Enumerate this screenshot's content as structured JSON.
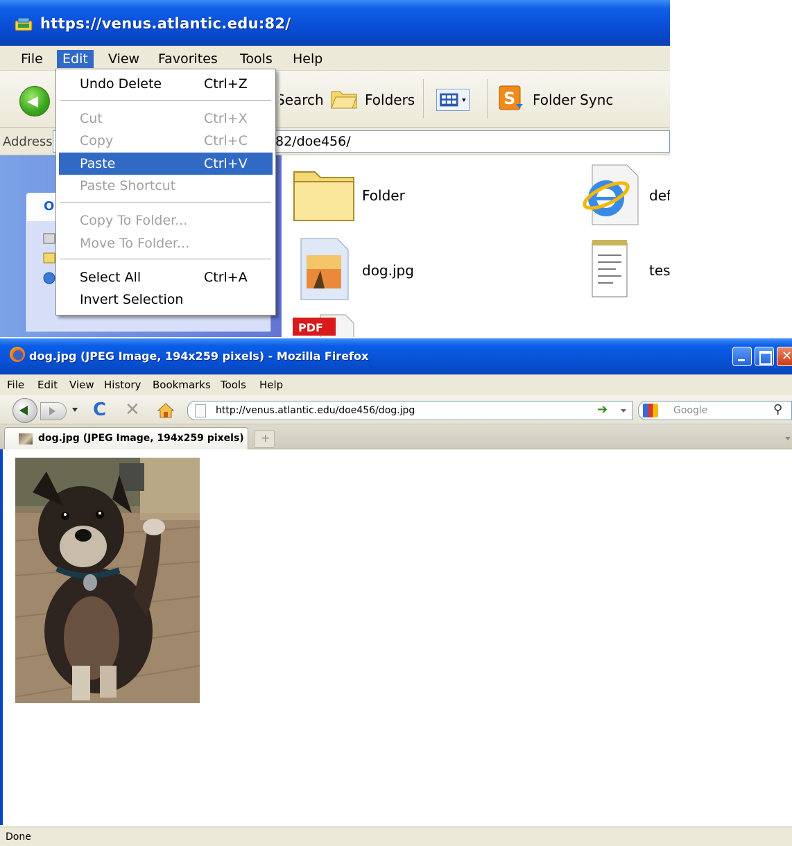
{
  "explorer": {
    "title": "https://venus.atlantic.edu:82/",
    "menu": [
      "File",
      "Edit",
      "View",
      "Favorites",
      "Tools",
      "Help"
    ],
    "toolbar": {
      "search_label": "Search",
      "folders_label": "Folders",
      "folder_sync_label": "Folder Sync"
    },
    "address": {
      "label": "Address",
      "value": "82/doe456/"
    },
    "task_panel_header": "O",
    "files": [
      {
        "name": "Folder",
        "type": "folder"
      },
      {
        "name": "def",
        "type": "ie-document"
      },
      {
        "name": "dog.jpg",
        "type": "image"
      },
      {
        "name": "tes",
        "type": "text-document"
      },
      {
        "name": "",
        "type": "pdf"
      }
    ],
    "edit_menu": {
      "items": [
        {
          "label": "Undo Delete",
          "shortcut": "Ctrl+Z",
          "state": "enabled"
        },
        {
          "label": "Cut",
          "shortcut": "Ctrl+X",
          "state": "disabled"
        },
        {
          "label": "Copy",
          "shortcut": "Ctrl+C",
          "state": "disabled"
        },
        {
          "label": "Paste",
          "shortcut": "Ctrl+V",
          "state": "highlighted"
        },
        {
          "label": "Paste Shortcut",
          "shortcut": "",
          "state": "disabled"
        },
        {
          "label": "Copy To Folder...",
          "shortcut": "",
          "state": "disabled"
        },
        {
          "label": "Move To Folder...",
          "shortcut": "",
          "state": "disabled"
        },
        {
          "label": "Select All",
          "shortcut": "Ctrl+A",
          "state": "enabled"
        },
        {
          "label": "Invert Selection",
          "shortcut": "",
          "state": "enabled"
        }
      ]
    },
    "colors": {
      "titlebar": "#0a4fd8",
      "menu_highlight": "#316ac5",
      "chrome": "#ece9d8"
    }
  },
  "firefox": {
    "title": "dog.jpg (JPEG Image, 194x259 pixels) - Mozilla Firefox",
    "menu": [
      "File",
      "Edit",
      "View",
      "History",
      "Bookmarks",
      "Tools",
      "Help"
    ],
    "url": "http://venus.atlantic.edu/doe456/dog.jpg",
    "search_placeholder": "Google",
    "tab_label": "dog.jpg (JPEG Image, 194x259 pixels)",
    "status": "Done",
    "icons": [
      "back-icon",
      "forward-icon",
      "reload-icon",
      "stop-icon",
      "home-icon",
      "go-icon",
      "search-engine-icon",
      "magnifier-icon"
    ]
  }
}
